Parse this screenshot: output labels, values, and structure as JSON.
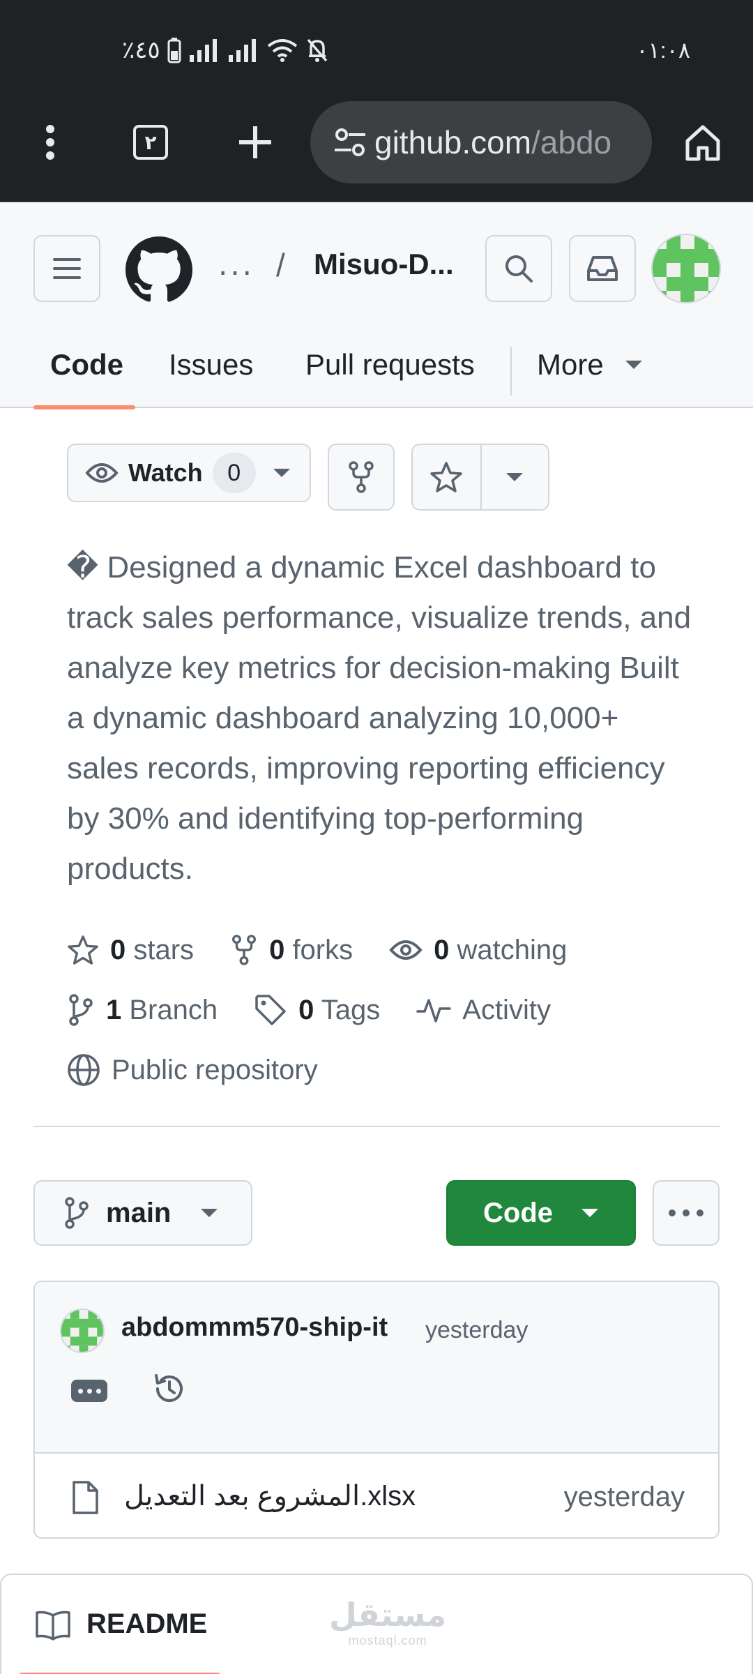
{
  "status_bar": {
    "battery": "٪٤٥",
    "time": "٠١:٠٨"
  },
  "browser": {
    "tab_count": "٢",
    "url_host": "github.com",
    "url_path": "/abdo"
  },
  "header": {
    "breadcrumb_dots": "···",
    "slash": "/",
    "repo_name": "Misuo-D..."
  },
  "nav": {
    "tabs": [
      "Code",
      "Issues",
      "Pull requests"
    ],
    "more_label": "More"
  },
  "actions": {
    "watch_label": "Watch",
    "watch_count": "0"
  },
  "description": "� Designed a dynamic Excel dashboard to track sales performance, visualize trends, and analyze key metrics for decision-making Built a dynamic dashboard analyzing 10,000+ sales records, improving reporting efficiency by 30% and identifying top-performing products.",
  "stats": {
    "stars_count": "0",
    "stars_label": "stars",
    "forks_count": "0",
    "forks_label": "forks",
    "watching_count": "0",
    "watching_label": "watching",
    "branch_count": "1",
    "branch_label": "Branch",
    "tags_count": "0",
    "tags_label": "Tags",
    "activity_label": "Activity",
    "visibility_label": "Public repository"
  },
  "branch": {
    "name": "main",
    "code_label": "Code"
  },
  "commit": {
    "author": "abdommm570-ship-it",
    "time": "yesterday"
  },
  "files": [
    {
      "name": "المشروع بعد التعديل.xlsx",
      "time": "yesterday"
    }
  ],
  "readme": {
    "label": "README"
  },
  "watermark": {
    "arabic": "مستقل",
    "latin": "mostaql.com"
  },
  "colors": {
    "accent_orange": "#fd8c73",
    "code_green": "#1f883d",
    "chrome_dark": "#202124",
    "header_bg": "#f6f8fa",
    "avatar_green": "#5fc35f"
  }
}
